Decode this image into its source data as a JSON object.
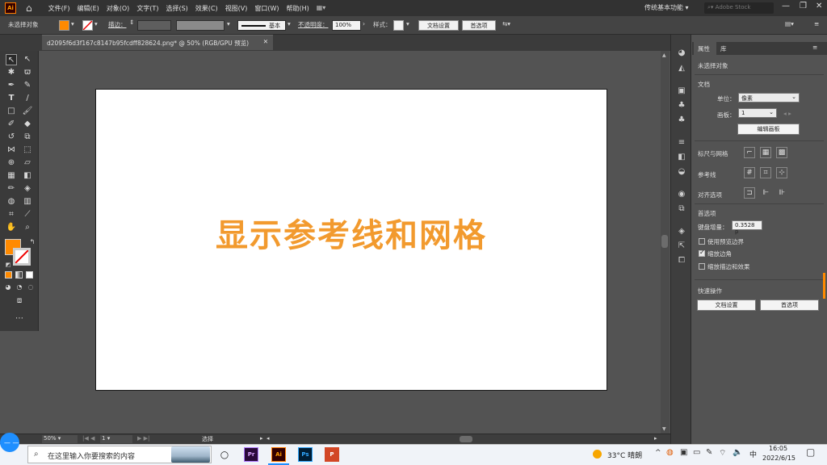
{
  "menubar": {
    "app_logo": "Ai",
    "items": [
      "文件(F)",
      "编辑(E)",
      "对象(O)",
      "文字(T)",
      "选择(S)",
      "效果(C)",
      "视图(V)",
      "窗口(W)",
      "帮助(H)"
    ],
    "workspace": "传统基本功能",
    "stock_placeholder": "Adobe Stock"
  },
  "controlbar": {
    "selection": "未选择对象",
    "stroke_label": "描边：",
    "stroke_style": "基本",
    "opacity_label": "不透明度：",
    "opacity_value": "100%",
    "style_label": "样式：",
    "doc_setup": "文档设置",
    "preferences": "首选项"
  },
  "document": {
    "tab_title": "d2095f6d3f167c8147b95fcdff828624.png* @ 50% (RGB/GPU 预览)"
  },
  "artboard": {
    "headline": "显示参考线和网格"
  },
  "statusbar": {
    "zoom": "50%",
    "page": "1",
    "tool": "选择"
  },
  "panel": {
    "tabs": [
      "属性",
      "库"
    ],
    "no_selection": "未选择对象",
    "doc_header": "文档",
    "units_label": "单位：",
    "units_value": "像素",
    "artboard_label": "画板：",
    "artboard_value": "1",
    "edit_artboards": "编辑画板",
    "rulers_grid": "标尺与网格",
    "guides": "参考线",
    "align_options": "对齐选项",
    "preferences_header": "首选项",
    "keyboard_increment_label": "键盘增量：",
    "keyboard_increment_value": "0.3528 p",
    "use_preview_bounds": "使用预览边界",
    "scale_corners": "缩放边角",
    "scale_strokes": "缩放描边和效果",
    "quick_actions": "快速操作",
    "doc_setup": "文档设置",
    "preferences": "首选项"
  },
  "taskbar": {
    "search_placeholder": "在这里输入你要搜索的内容",
    "apps": [
      "Pr",
      "Ai",
      "Ps",
      "P"
    ],
    "weather": "33°C 晴朗",
    "ime": "中",
    "time": "16:05",
    "date": "2022/6/15"
  },
  "colors": {
    "fill": "#ff8a00",
    "headline": "#f29a2e",
    "accent": "#1f8fff"
  }
}
